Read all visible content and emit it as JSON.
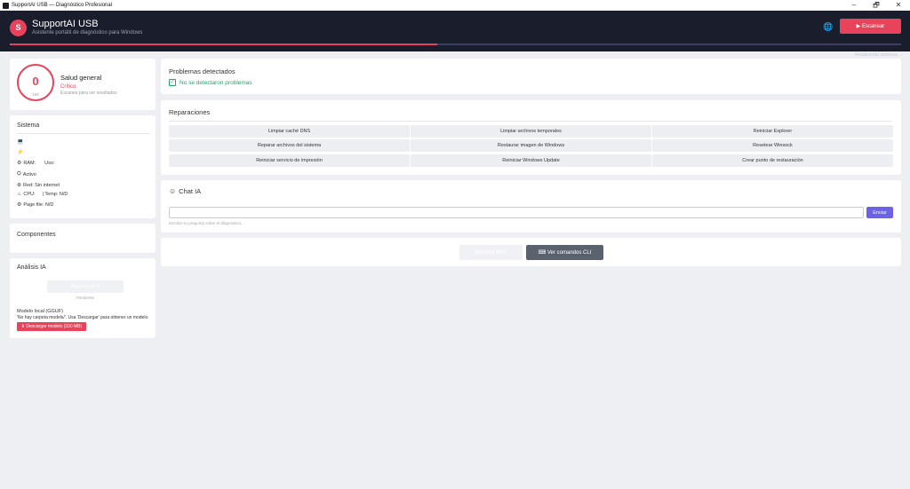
{
  "window": {
    "title": "SupportAI USB — Diagnóstico Profesional",
    "minimize": "–",
    "restore": "🗗",
    "close": "✕"
  },
  "header": {
    "logo_letter": "S",
    "app_name": "SupportAI USB",
    "subtitle": "Asistente portátil de diagnóstico para Windows",
    "language_icon": "🌐",
    "scan_label": "▶ Escanear",
    "progress_percent": 48,
    "status": "Analizando sistema...",
    "accent_color": "#e8435a"
  },
  "health": {
    "score": "0",
    "max": "100",
    "title": "Salud general",
    "level": "Crítico",
    "hint": "Escanea para ver resultados"
  },
  "system": {
    "title": "Sistema",
    "rows": [
      {
        "icon": "💻",
        "text": ""
      },
      {
        "icon": "⚡",
        "text": ""
      },
      {
        "icon": "RAM:",
        "text": "Uso:"
      },
      {
        "icon": "",
        "text": "Activo"
      },
      {
        "icon": "",
        "text": "Red: Sin internet"
      },
      {
        "icon": "CPU:",
        "text": "| Temp: N/D"
      },
      {
        "icon": "",
        "text": "Page file: N/D"
      }
    ]
  },
  "components": {
    "title": "Componentes"
  },
  "ai_analysis": {
    "title": "Análisis IA",
    "button_label": "Analizar con IA",
    "button_caption": "Pendiente",
    "model_line": "Modelo local (GGUF)",
    "model_hint": "'No hay carpeta models/'. Usa 'Descargar' para obtener un modelo.",
    "download_label": "⬇ Descargar modelo (330 MB)"
  },
  "problems": {
    "title": "Problemas detectados",
    "ok_text": "No se detectaron problemas"
  },
  "repairs": {
    "title": "Reparaciones",
    "buttons": [
      "Limpiar caché DNS",
      "Limpiar archivos temporales",
      "Reiniciar Explorer",
      "Reparar archivos del sistema",
      "Restaurar imagen de Windows",
      "Resetear Winsock",
      "Reiniciar servicio de impresión",
      "Reiniciar Windows Update",
      "Crear punto de restauración"
    ]
  },
  "chat": {
    "title": "Chat IA",
    "input_value": "",
    "send_label": "Enviar",
    "hint": "Escribe su pregunta sobre el diagnóstico..."
  },
  "footer": {
    "export_label": "Exportar PDF",
    "commands_label": "⌨ Ver comandos CLI"
  }
}
